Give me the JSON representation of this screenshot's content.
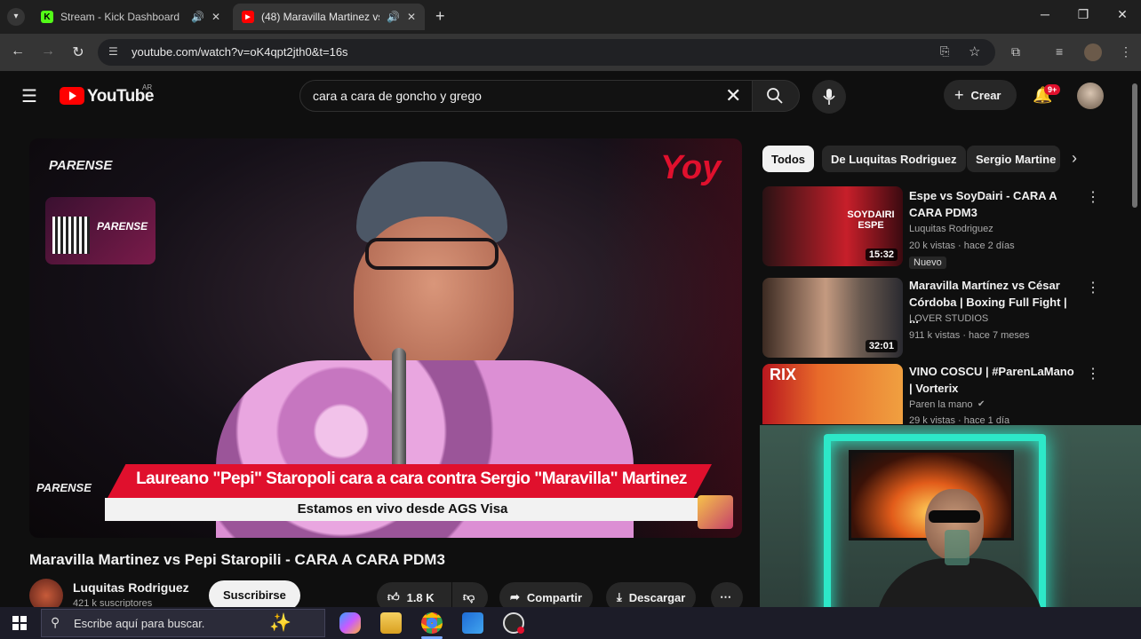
{
  "browser": {
    "tabs": [
      {
        "title": "Stream - Kick Dashboard",
        "favicon": "K",
        "favicon_color": "#53fc18"
      },
      {
        "title": "(48) Maravilla Martinez vs P",
        "favicon": "▶",
        "favicon_color": "#ff0000"
      }
    ],
    "url": "youtube.com/watch?v=oK4qpt2jth0&t=16s"
  },
  "youtube": {
    "logo_text": "YouTube",
    "region": "AR",
    "search_value": "cara a cara de goncho y grego",
    "create_label": "Crear",
    "notif_badge": "9+",
    "video": {
      "overlay_title": "Laureano \"Pepi\" Staropoli cara a cara contra Sergio \"Maravilla\" Martinez",
      "overlay_subtitle": "Estamos en vivo desde AGS Visa",
      "brand_top": "PARENSE",
      "brand_corner": "Yoy",
      "title": "Maravilla Martinez vs Pepi Staropili - CARA A CARA PDM3",
      "channel": "Luquitas Rodriguez",
      "subscribers": "421 k suscriptores",
      "subscribe_label": "Suscribirse",
      "likes": "1.8 K",
      "share_label": "Compartir",
      "download_label": "Descargar"
    },
    "chips": [
      "Todos",
      "De Luquitas Rodriguez",
      "Sergio Martine"
    ],
    "recommendations": [
      {
        "title": "Espe vs SoyDairi - CARA A CARA PDM3",
        "channel": "Luquitas Rodriguez",
        "meta": "20 k vistas · hace 2 días",
        "badge": "Nuevo",
        "duration": "15:32",
        "thumb_text": "SOYDAIRI ESPE"
      },
      {
        "title": "Maravilla Martínez vs César Córdoba | Boxing Full Fight | ...",
        "channel": "LOVER STUDIOS",
        "meta": "911 k vistas · hace 7 meses",
        "badge": "",
        "duration": "32:01",
        "thumb_text": ""
      },
      {
        "title": "VINO COSCU | #ParenLaMano | Vorterix",
        "channel": "Paren la mano",
        "meta": "29 k vistas · hace 1 día",
        "badge": "",
        "duration": "",
        "thumb_text": "RIX"
      }
    ]
  },
  "taskbar": {
    "search_placeholder": "Escribe aquí para buscar."
  },
  "colors": {
    "accent": "#ff0000",
    "overlay_red": "#e0102d",
    "webcam_glow": "#2de8c8"
  }
}
